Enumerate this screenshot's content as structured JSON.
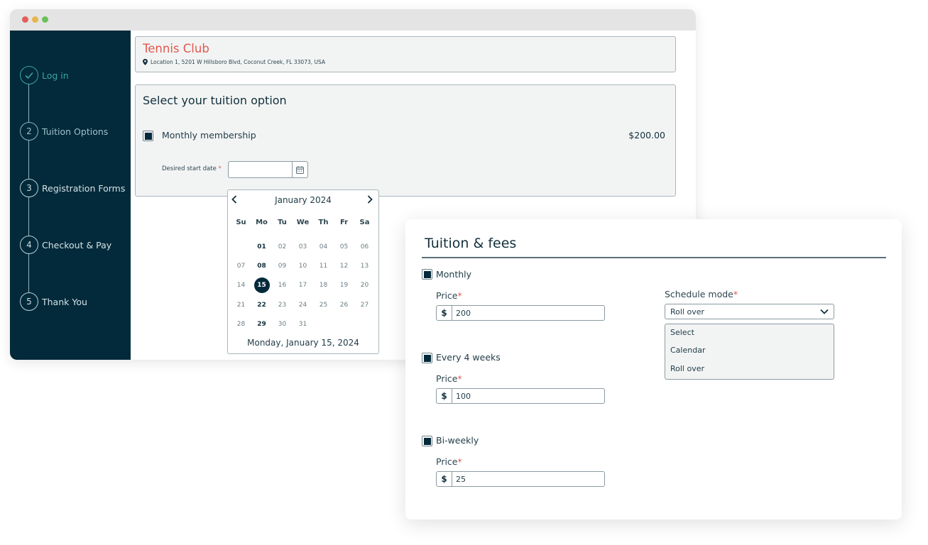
{
  "window": {
    "traffic_lights": [
      "close",
      "minimize",
      "maximize"
    ]
  },
  "stepper": {
    "steps": [
      {
        "number": "1",
        "label": "Log in",
        "state": "done"
      },
      {
        "number": "2",
        "label": "Tuition Options",
        "state": "active"
      },
      {
        "number": "3",
        "label": "Registration Forms",
        "state": "pending"
      },
      {
        "number": "4",
        "label": "Checkout & Pay",
        "state": "pending"
      },
      {
        "number": "5",
        "label": "Thank You",
        "state": "pending"
      }
    ]
  },
  "club": {
    "name": "Tennis Club",
    "address": "Location 1, 5201 W Hillsboro Blvd, Coconut Creek, FL 33073, USA"
  },
  "tuition": {
    "title": "Select your tuition option",
    "option_label": "Monthly membership",
    "option_checked": true,
    "option_price": "$200.00",
    "start_date_label": "Desired start date",
    "required_mark": "*",
    "start_date_value": ""
  },
  "calendar": {
    "month_label": "January 2024",
    "weekdays": [
      "Su",
      "Mo",
      "Tu",
      "We",
      "Th",
      "Fr",
      "Sa"
    ],
    "leading_blanks": 1,
    "days": [
      "01",
      "02",
      "03",
      "04",
      "05",
      "06",
      "07",
      "08",
      "09",
      "10",
      "11",
      "12",
      "13",
      "14",
      "15",
      "16",
      "17",
      "18",
      "19",
      "20",
      "21",
      "22",
      "23",
      "24",
      "25",
      "26",
      "27",
      "28",
      "29",
      "30",
      "31"
    ],
    "selected_day": "15",
    "emphasized_weekday": "Mo",
    "footer": "Monday, January 15, 2024"
  },
  "fees": {
    "title": "Tuition & fees",
    "price_label": "Price",
    "required_mark": "*",
    "currency_symbol": "$",
    "plans": [
      {
        "label": "Monthly",
        "checked": true,
        "price": "200"
      },
      {
        "label": "Every 4 weeks",
        "checked": true,
        "price": "100"
      },
      {
        "label": "Bi-weekly",
        "checked": true,
        "price": "25"
      }
    ],
    "schedule_mode": {
      "label": "Schedule mode",
      "value": "Roll over",
      "options": [
        "Select",
        "Calendar",
        "Roll over"
      ]
    }
  },
  "colors": {
    "sidebar_bg": "#022a3a",
    "brand_red": "#e2574c",
    "accent_teal": "#3aa3a3",
    "selected_day_bg": "#022a3a"
  }
}
